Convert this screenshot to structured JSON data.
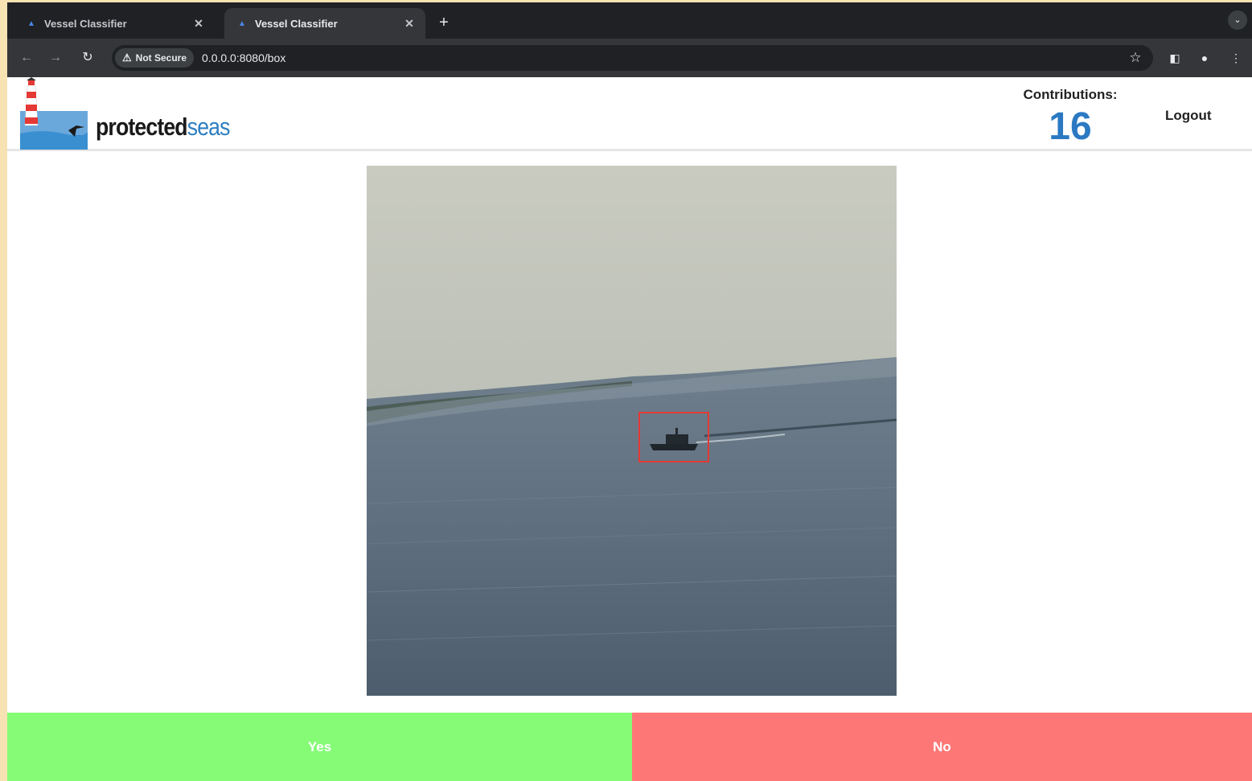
{
  "browser": {
    "tabs": [
      {
        "title": "Vessel Classifier",
        "active": false
      },
      {
        "title": "Vessel Classifier",
        "active": true
      }
    ],
    "new_tab_label": "+",
    "security_label": "Not Secure",
    "url": "0.0.0.0:8080/box"
  },
  "header": {
    "brand_part1": "protected",
    "brand_part2": "seas",
    "contributions_label": "Contributions:",
    "contributions_count": "16",
    "logout_label": "Logout"
  },
  "actions": {
    "yes_label": "Yes",
    "no_label": "No"
  },
  "colors": {
    "yes_bg": "#85fb76",
    "no_bg": "#fd7777",
    "brand_blue": "#2f7fc1",
    "count_blue": "#2b79c2",
    "detection_box": "#e53935"
  },
  "icons": [
    "back-arrow-icon",
    "forward-arrow-icon",
    "reload-icon",
    "warning-icon",
    "star-icon",
    "sidepanel-icon",
    "profile-icon",
    "kebab-menu-icon",
    "close-icon",
    "chevron-down-icon"
  ]
}
